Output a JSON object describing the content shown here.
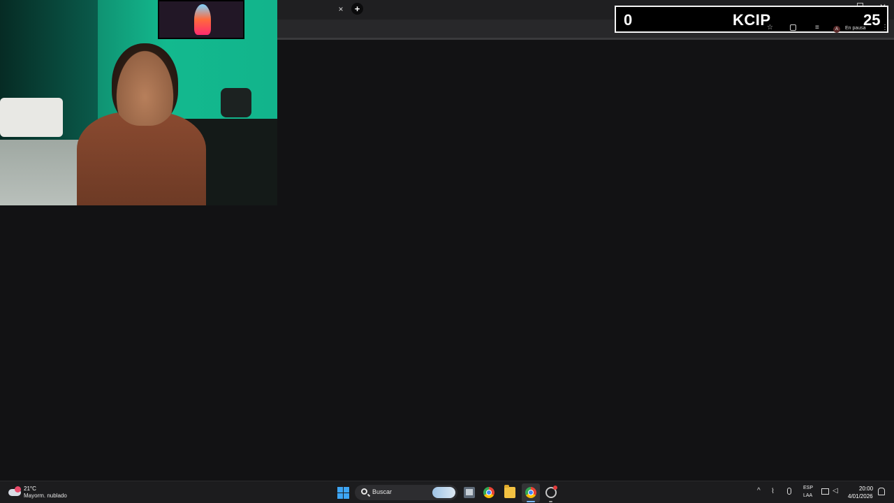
{
  "browser": {
    "tab_close_glyph": "×",
    "new_tab_glyph": "+"
  },
  "scoreboard": {
    "left_score": "0",
    "title": "KCIP",
    "right_score": "25",
    "paused_label": "En pausa",
    "avatar_letter": "A"
  },
  "taskbar": {
    "weather": {
      "temp": "21°C",
      "description": "Mayorm. nublado"
    },
    "search_label": "Buscar",
    "language": {
      "line1": "ESP",
      "line2": "LAA"
    },
    "clock": {
      "time": "20:00",
      "date": "4/01/2026"
    }
  },
  "colors": {
    "background": "#121214",
    "taskbar": "#1c1c1e",
    "accent": "#3da5f4",
    "webcam_wall": "#13b98e"
  }
}
